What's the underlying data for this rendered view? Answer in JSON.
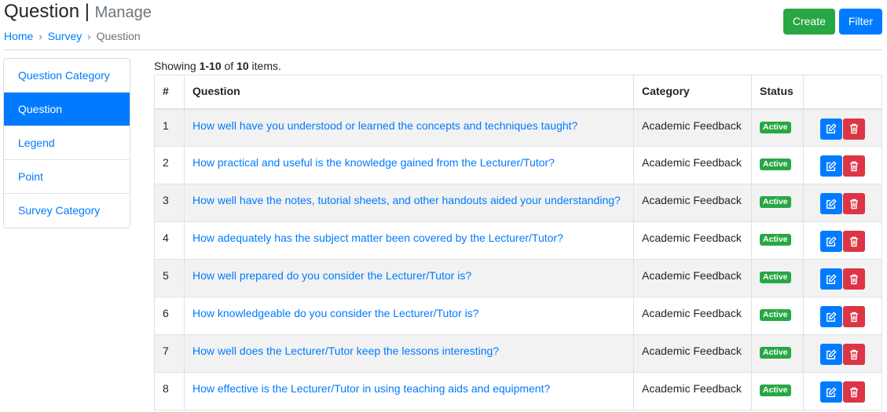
{
  "header": {
    "title": "Question",
    "separator": "|",
    "subtitle": "Manage",
    "breadcrumb": [
      {
        "label": "Home",
        "link": true
      },
      {
        "label": "Survey",
        "link": true
      },
      {
        "label": "Question",
        "link": false
      }
    ],
    "breadcrumb_separator": "›"
  },
  "actions": {
    "create_label": "Create",
    "filter_label": "Filter"
  },
  "colors": {
    "primary": "#007bff",
    "success": "#28a745",
    "danger": "#dc3545"
  },
  "sidebar": {
    "items": [
      {
        "label": "Question Category",
        "active": false
      },
      {
        "label": "Question",
        "active": true
      },
      {
        "label": "Legend",
        "active": false
      },
      {
        "label": "Point",
        "active": false
      },
      {
        "label": "Survey Category",
        "active": false
      }
    ]
  },
  "summary": {
    "prefix": "Showing ",
    "range": "1-10",
    "middle": " of ",
    "total": "10",
    "suffix": " items."
  },
  "table": {
    "columns": [
      "#",
      "Question",
      "Category",
      "Status",
      ""
    ],
    "rows": [
      {
        "num": "1",
        "question": "How well have you understood or learned the concepts and techniques taught?",
        "category": "Academic Feedback",
        "status": "Active"
      },
      {
        "num": "2",
        "question": "How practical and useful is the knowledge gained from the Lecturer/Tutor?",
        "category": "Academic Feedback",
        "status": "Active"
      },
      {
        "num": "3",
        "question": "How well have the notes, tutorial sheets, and other handouts aided your understanding?",
        "category": "Academic Feedback",
        "status": "Active"
      },
      {
        "num": "4",
        "question": "How adequately has the subject matter been covered by the Lecturer/Tutor?",
        "category": "Academic Feedback",
        "status": "Active"
      },
      {
        "num": "5",
        "question": "How well prepared do you consider the Lecturer/Tutor is?",
        "category": "Academic Feedback",
        "status": "Active"
      },
      {
        "num": "6",
        "question": "How knowledgeable do you consider the Lecturer/Tutor is?",
        "category": "Academic Feedback",
        "status": "Active"
      },
      {
        "num": "7",
        "question": "How well does the Lecturer/Tutor keep the lessons interesting?",
        "category": "Academic Feedback",
        "status": "Active"
      },
      {
        "num": "8",
        "question": "How effective is the Lecturer/Tutor in using teaching aids and equipment?",
        "category": "Academic Feedback",
        "status": "Active"
      }
    ],
    "row_actions": {
      "edit_icon": "edit-icon",
      "delete_icon": "trash-icon"
    }
  }
}
